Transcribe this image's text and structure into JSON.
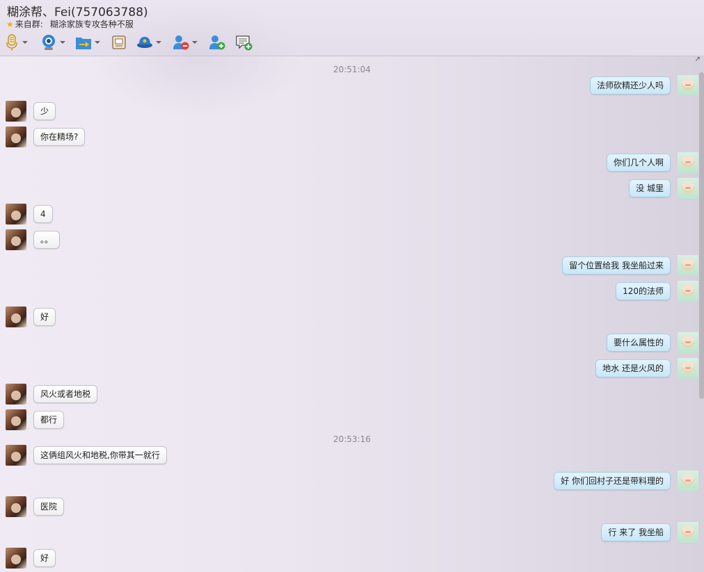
{
  "header": {
    "contact_name": "糊涂帮、Fei(757063788)",
    "group_prefix": "来自群:",
    "group_name": "糊涂家族专攻各种不服"
  },
  "toolbar": {
    "buttons": [
      {
        "name": "voice",
        "icon": "microphone-icon",
        "dropdown": true
      },
      {
        "name": "video",
        "icon": "webcam-icon",
        "dropdown": true
      },
      {
        "name": "file",
        "icon": "folder-transfer-icon",
        "dropdown": true
      },
      {
        "name": "screen",
        "icon": "remote-desktop-icon",
        "dropdown": false
      },
      {
        "name": "app",
        "icon": "hat-icon",
        "dropdown": true
      },
      {
        "name": "remove",
        "icon": "remove-user-icon",
        "dropdown": true
      },
      {
        "name": "add",
        "icon": "add-user-icon",
        "dropdown": false
      },
      {
        "name": "notes",
        "icon": "add-note-icon",
        "dropdown": false
      }
    ],
    "colors": {
      "blue": "#2e86d6",
      "red": "#e04040",
      "green": "#3aa840",
      "orange": "#f0a020"
    }
  },
  "chat": {
    "timestamp_1": "20:51:04",
    "timestamp_2": "20:53:16",
    "messages": [
      {
        "side": "right",
        "text": "法师砍精还少人吗"
      },
      {
        "side": "left",
        "text": "少"
      },
      {
        "side": "left",
        "text": "你在精场?"
      },
      {
        "side": "right",
        "text": "你们几个人啊"
      },
      {
        "side": "right",
        "text": "没  城里"
      },
      {
        "side": "left",
        "text": "4"
      },
      {
        "side": "left",
        "text": "。。"
      },
      {
        "side": "right",
        "text": "留个位置给我  我坐船过来"
      },
      {
        "side": "right",
        "text": "120的法师"
      },
      {
        "side": "left",
        "text": "好"
      },
      {
        "side": "right",
        "text": "要什么属性的"
      },
      {
        "side": "right",
        "text": "地水  还是火风的"
      },
      {
        "side": "left",
        "text": "风火或者地税"
      },
      {
        "side": "left",
        "text": "都行"
      },
      {
        "side": "left",
        "text": "这俩组风火和地税,你带其一就行"
      },
      {
        "side": "right",
        "text": "好  你们回村子还是带料理的"
      },
      {
        "side": "left",
        "text": "医院"
      },
      {
        "side": "right",
        "text": "行  来了  我坐船"
      },
      {
        "side": "left",
        "text": "好"
      }
    ]
  }
}
